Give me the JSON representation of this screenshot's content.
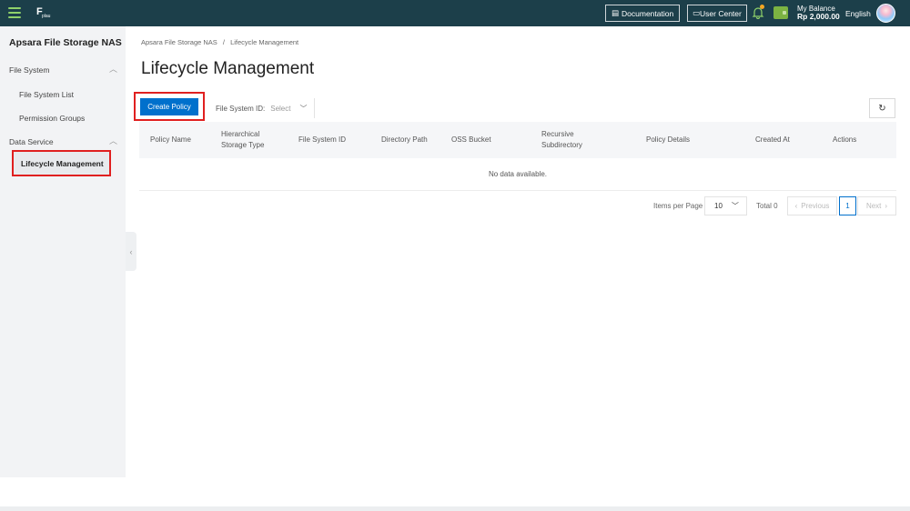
{
  "topbar": {
    "logo_text": "F",
    "logo_sub": "plau",
    "documentation": "Documentation",
    "user_center": "User Center",
    "balance_label": "My Balance",
    "balance_value": "Rp 2,000.00",
    "language": "English"
  },
  "sidebar": {
    "title": "Apsara File Storage NAS",
    "groups": [
      {
        "label": "File System",
        "items": [
          "File System List",
          "Permission Groups"
        ]
      },
      {
        "label": "Data Service",
        "items": [
          "Lifecycle Management"
        ]
      }
    ],
    "active_item": "Lifecycle Management"
  },
  "breadcrumb": {
    "root": "Apsara File Storage NAS",
    "separator": "/",
    "current": "Lifecycle Management"
  },
  "page": {
    "title": "Lifecycle Management",
    "create_button": "Create Policy",
    "filter_label": "File System ID:",
    "filter_placeholder": "Select"
  },
  "table": {
    "columns": [
      "Policy Name",
      "Hierarchical Storage Type",
      "File System ID",
      "Directory Path",
      "OSS Bucket",
      "Recursive Subdirectory",
      "Policy Details",
      "Created At",
      "Actions"
    ],
    "empty_text": "No data available."
  },
  "pagination": {
    "items_per_page_label": "Items per Page",
    "items_per_page": "10",
    "total": "Total 0",
    "previous": "Previous",
    "current_page": "1",
    "next": "Next"
  },
  "colors": {
    "topbar_bg": "#1c3f4a",
    "primary": "#0070cc",
    "highlight": "#e02020"
  }
}
